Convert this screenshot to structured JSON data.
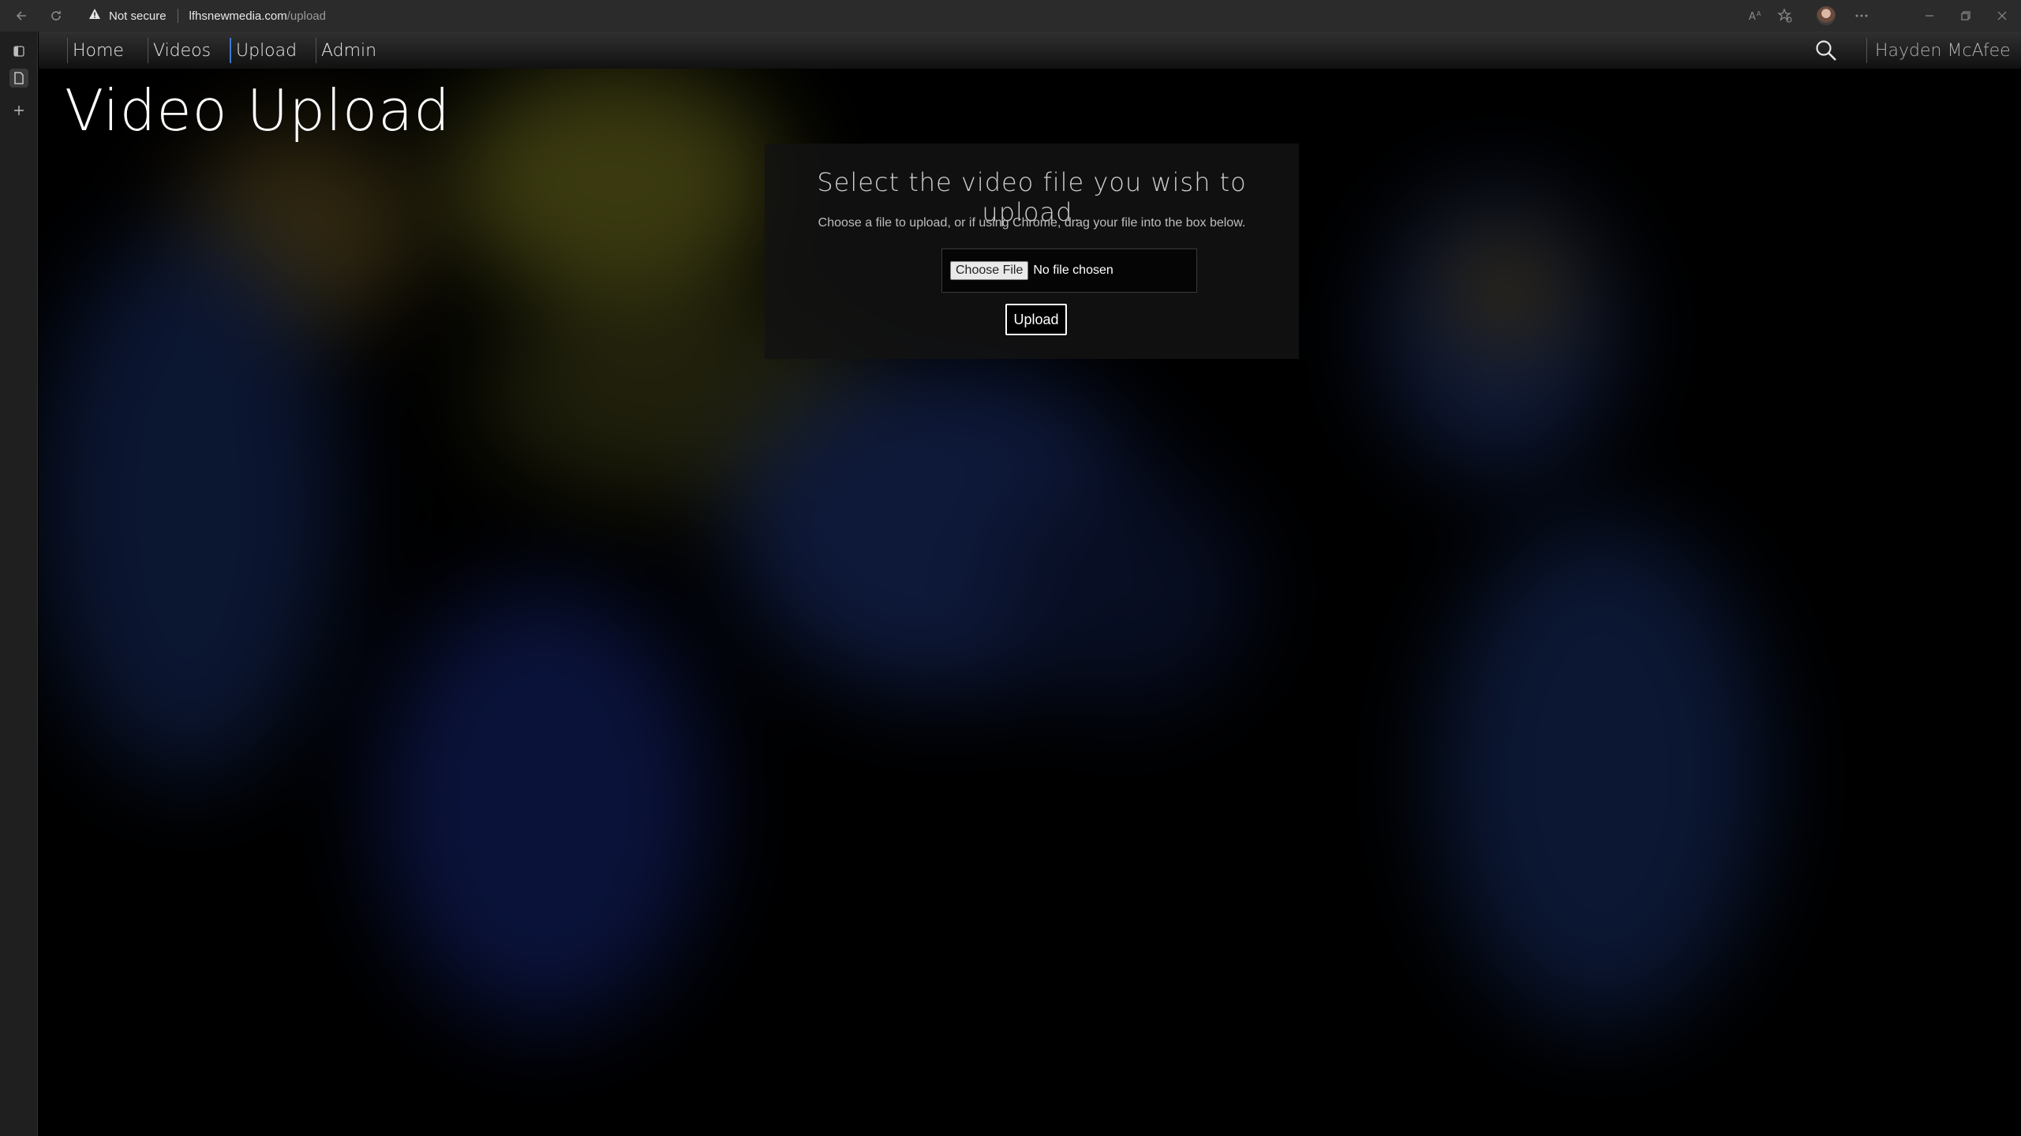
{
  "browser": {
    "security_label": "Not secure",
    "url_host": "lfhsnewmedia.com",
    "url_path": "/upload"
  },
  "nav": {
    "items": [
      {
        "label": "Home"
      },
      {
        "label": "Videos"
      },
      {
        "label": "Upload"
      },
      {
        "label": "Admin"
      }
    ],
    "user_name": "Hayden McAfee"
  },
  "page": {
    "title": "Video Upload",
    "panel": {
      "heading": "Select the video file you wish to upload.",
      "subtext": "Choose a file to upload, or if using Chrome, drag your file into the box below.",
      "choose_file_label": "Choose File",
      "file_status": "No file chosen",
      "upload_label": "Upload"
    }
  },
  "colors": {
    "nav_active": "#3b7bd5",
    "background": "#000000"
  }
}
